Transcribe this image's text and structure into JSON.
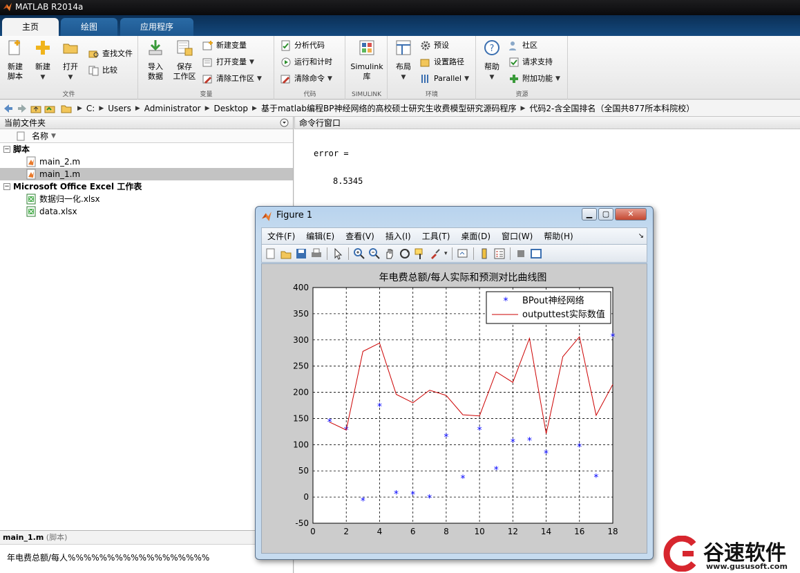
{
  "app": {
    "title": "MATLAB R2014a"
  },
  "tabs": [
    {
      "label": "主页",
      "active": true
    },
    {
      "label": "绘图",
      "active": false
    },
    {
      "label": "应用程序",
      "active": false
    }
  ],
  "ribbon": {
    "file": {
      "section": "文件",
      "new_script": "新建\n脚本",
      "new": "新建",
      "open": "打开",
      "find_files": "查找文件",
      "compare": "比较"
    },
    "variable": {
      "section": "变量",
      "import": "导入\n数据",
      "save_ws": "保存\n工作区",
      "new_var": "新建变量",
      "open_var": "打开变量",
      "clear_ws": "清除工作区"
    },
    "code": {
      "section": "代码",
      "analyze": "分析代码",
      "run_time": "运行和计时",
      "clear_cmd": "清除命令"
    },
    "simulink": {
      "section": "SIMULINK",
      "lib": "Simulink\n库"
    },
    "env": {
      "section": "环境",
      "layout": "布局",
      "prefs": "预设",
      "set_path": "设置路径",
      "parallel": "Parallel"
    },
    "resources": {
      "section": "资源",
      "help": "帮助",
      "community": "社区",
      "request_support": "请求支持",
      "addons": "附加功能"
    }
  },
  "address": {
    "crumbs": [
      "C:",
      "Users",
      "Administrator",
      "Desktop",
      "基于matlab编程BP神经网络的高校硕士研究生收费模型研究源码程序",
      "代码2-含全国排名（全国共877所本科院校）"
    ]
  },
  "current_folder": {
    "title": "当前文件夹",
    "column": "名称",
    "groups": [
      {
        "name": "脚本",
        "files": [
          "main_2.m",
          "main_1.m"
        ]
      },
      {
        "name": "Microsoft Office Excel 工作表",
        "files": [
          "数据归一化.xlsx",
          "data.xlsx"
        ]
      }
    ],
    "selected": "main_1.m"
  },
  "details": {
    "title": "main_1.m",
    "kind": "(脚本)",
    "line": "年电费总额/每人%%%%%%%%%%%%%%%%%%"
  },
  "command_window": {
    "title": "命令行窗口",
    "line1": "error =",
    "line2": "8.5345"
  },
  "figure": {
    "title": "Figure 1",
    "menus": [
      "文件(F)",
      "编辑(E)",
      "查看(V)",
      "插入(I)",
      "工具(T)",
      "桌面(D)",
      "窗口(W)",
      "帮助(H)"
    ]
  },
  "chart_data": {
    "type": "line",
    "title": "年电费总额/每人实际和预测对比曲线图",
    "xlabel": "",
    "ylabel": "",
    "xlim": [
      0,
      18
    ],
    "ylim": [
      -50,
      400
    ],
    "xticks": [
      0,
      2,
      4,
      6,
      8,
      10,
      12,
      14,
      16,
      18
    ],
    "yticks": [
      -50,
      0,
      50,
      100,
      150,
      200,
      250,
      300,
      350,
      400
    ],
    "grid": true,
    "legend_position": "top-right",
    "series": [
      {
        "name": "BPout神经网络",
        "style": "markers",
        "marker": "*",
        "color": "#0000ff",
        "x": [
          1,
          2,
          3,
          4,
          5,
          6,
          7,
          8,
          9,
          10,
          11,
          12,
          13,
          14,
          15,
          16,
          17,
          18
        ],
        "y": [
          143,
          128,
          -7,
          173,
          6,
          5,
          -2,
          115,
          36,
          128,
          52,
          105,
          108,
          83,
          null,
          96,
          38,
          306
        ]
      },
      {
        "name": "outputtest实际数值",
        "style": "line",
        "color": "#cc0000",
        "x": [
          1,
          2,
          3,
          4,
          5,
          6,
          7,
          8,
          9,
          10,
          11,
          12,
          13,
          14,
          15,
          16,
          17,
          18
        ],
        "y": [
          143,
          128,
          278,
          294,
          196,
          180,
          204,
          194,
          157,
          155,
          239,
          219,
          303,
          121,
          268,
          306,
          156,
          215
        ]
      }
    ]
  },
  "watermark": {
    "brand": "谷速软件",
    "url": "www.gususoft.com"
  },
  "colors": {
    "tab_bar": "#14497e",
    "title_bar": "#0a0a0c",
    "selection": "#c3c3c3"
  }
}
